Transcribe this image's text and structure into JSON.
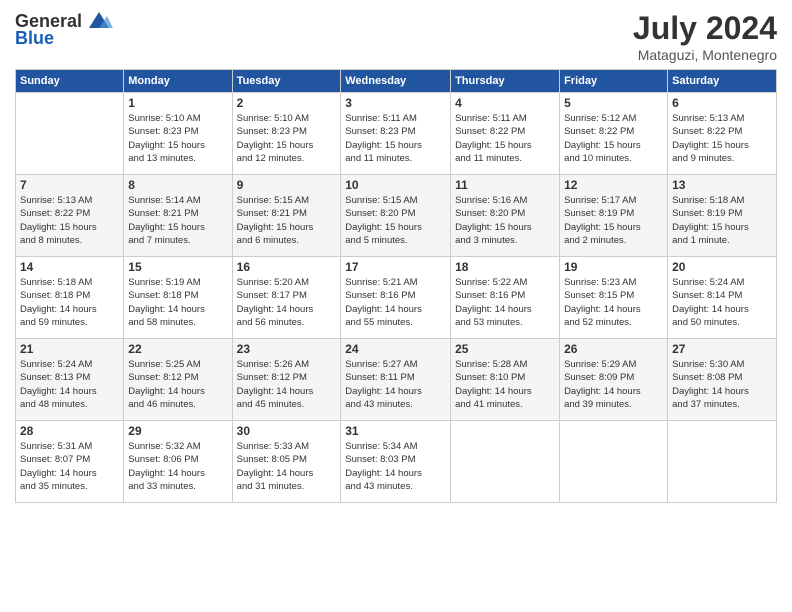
{
  "logo": {
    "text_general": "General",
    "text_blue": "Blue"
  },
  "title": {
    "month_year": "July 2024",
    "location": "Mataguzi, Montenegro"
  },
  "days_of_week": [
    "Sunday",
    "Monday",
    "Tuesday",
    "Wednesday",
    "Thursday",
    "Friday",
    "Saturday"
  ],
  "weeks": [
    [
      {
        "day": "",
        "info": ""
      },
      {
        "day": "1",
        "info": "Sunrise: 5:10 AM\nSunset: 8:23 PM\nDaylight: 15 hours\nand 13 minutes."
      },
      {
        "day": "2",
        "info": "Sunrise: 5:10 AM\nSunset: 8:23 PM\nDaylight: 15 hours\nand 12 minutes."
      },
      {
        "day": "3",
        "info": "Sunrise: 5:11 AM\nSunset: 8:23 PM\nDaylight: 15 hours\nand 11 minutes."
      },
      {
        "day": "4",
        "info": "Sunrise: 5:11 AM\nSunset: 8:22 PM\nDaylight: 15 hours\nand 11 minutes."
      },
      {
        "day": "5",
        "info": "Sunrise: 5:12 AM\nSunset: 8:22 PM\nDaylight: 15 hours\nand 10 minutes."
      },
      {
        "day": "6",
        "info": "Sunrise: 5:13 AM\nSunset: 8:22 PM\nDaylight: 15 hours\nand 9 minutes."
      }
    ],
    [
      {
        "day": "7",
        "info": "Sunrise: 5:13 AM\nSunset: 8:22 PM\nDaylight: 15 hours\nand 8 minutes."
      },
      {
        "day": "8",
        "info": "Sunrise: 5:14 AM\nSunset: 8:21 PM\nDaylight: 15 hours\nand 7 minutes."
      },
      {
        "day": "9",
        "info": "Sunrise: 5:15 AM\nSunset: 8:21 PM\nDaylight: 15 hours\nand 6 minutes."
      },
      {
        "day": "10",
        "info": "Sunrise: 5:15 AM\nSunset: 8:20 PM\nDaylight: 15 hours\nand 5 minutes."
      },
      {
        "day": "11",
        "info": "Sunrise: 5:16 AM\nSunset: 8:20 PM\nDaylight: 15 hours\nand 3 minutes."
      },
      {
        "day": "12",
        "info": "Sunrise: 5:17 AM\nSunset: 8:19 PM\nDaylight: 15 hours\nand 2 minutes."
      },
      {
        "day": "13",
        "info": "Sunrise: 5:18 AM\nSunset: 8:19 PM\nDaylight: 15 hours\nand 1 minute."
      }
    ],
    [
      {
        "day": "14",
        "info": "Sunrise: 5:18 AM\nSunset: 8:18 PM\nDaylight: 14 hours\nand 59 minutes."
      },
      {
        "day": "15",
        "info": "Sunrise: 5:19 AM\nSunset: 8:18 PM\nDaylight: 14 hours\nand 58 minutes."
      },
      {
        "day": "16",
        "info": "Sunrise: 5:20 AM\nSunset: 8:17 PM\nDaylight: 14 hours\nand 56 minutes."
      },
      {
        "day": "17",
        "info": "Sunrise: 5:21 AM\nSunset: 8:16 PM\nDaylight: 14 hours\nand 55 minutes."
      },
      {
        "day": "18",
        "info": "Sunrise: 5:22 AM\nSunset: 8:16 PM\nDaylight: 14 hours\nand 53 minutes."
      },
      {
        "day": "19",
        "info": "Sunrise: 5:23 AM\nSunset: 8:15 PM\nDaylight: 14 hours\nand 52 minutes."
      },
      {
        "day": "20",
        "info": "Sunrise: 5:24 AM\nSunset: 8:14 PM\nDaylight: 14 hours\nand 50 minutes."
      }
    ],
    [
      {
        "day": "21",
        "info": "Sunrise: 5:24 AM\nSunset: 8:13 PM\nDaylight: 14 hours\nand 48 minutes."
      },
      {
        "day": "22",
        "info": "Sunrise: 5:25 AM\nSunset: 8:12 PM\nDaylight: 14 hours\nand 46 minutes."
      },
      {
        "day": "23",
        "info": "Sunrise: 5:26 AM\nSunset: 8:12 PM\nDaylight: 14 hours\nand 45 minutes."
      },
      {
        "day": "24",
        "info": "Sunrise: 5:27 AM\nSunset: 8:11 PM\nDaylight: 14 hours\nand 43 minutes."
      },
      {
        "day": "25",
        "info": "Sunrise: 5:28 AM\nSunset: 8:10 PM\nDaylight: 14 hours\nand 41 minutes."
      },
      {
        "day": "26",
        "info": "Sunrise: 5:29 AM\nSunset: 8:09 PM\nDaylight: 14 hours\nand 39 minutes."
      },
      {
        "day": "27",
        "info": "Sunrise: 5:30 AM\nSunset: 8:08 PM\nDaylight: 14 hours\nand 37 minutes."
      }
    ],
    [
      {
        "day": "28",
        "info": "Sunrise: 5:31 AM\nSunset: 8:07 PM\nDaylight: 14 hours\nand 35 minutes."
      },
      {
        "day": "29",
        "info": "Sunrise: 5:32 AM\nSunset: 8:06 PM\nDaylight: 14 hours\nand 33 minutes."
      },
      {
        "day": "30",
        "info": "Sunrise: 5:33 AM\nSunset: 8:05 PM\nDaylight: 14 hours\nand 31 minutes."
      },
      {
        "day": "31",
        "info": "Sunrise: 5:34 AM\nSunset: 8:03 PM\nDaylight: 14 hours\nand 43 minutes."
      },
      {
        "day": "",
        "info": ""
      },
      {
        "day": "",
        "info": ""
      },
      {
        "day": "",
        "info": ""
      }
    ]
  ]
}
